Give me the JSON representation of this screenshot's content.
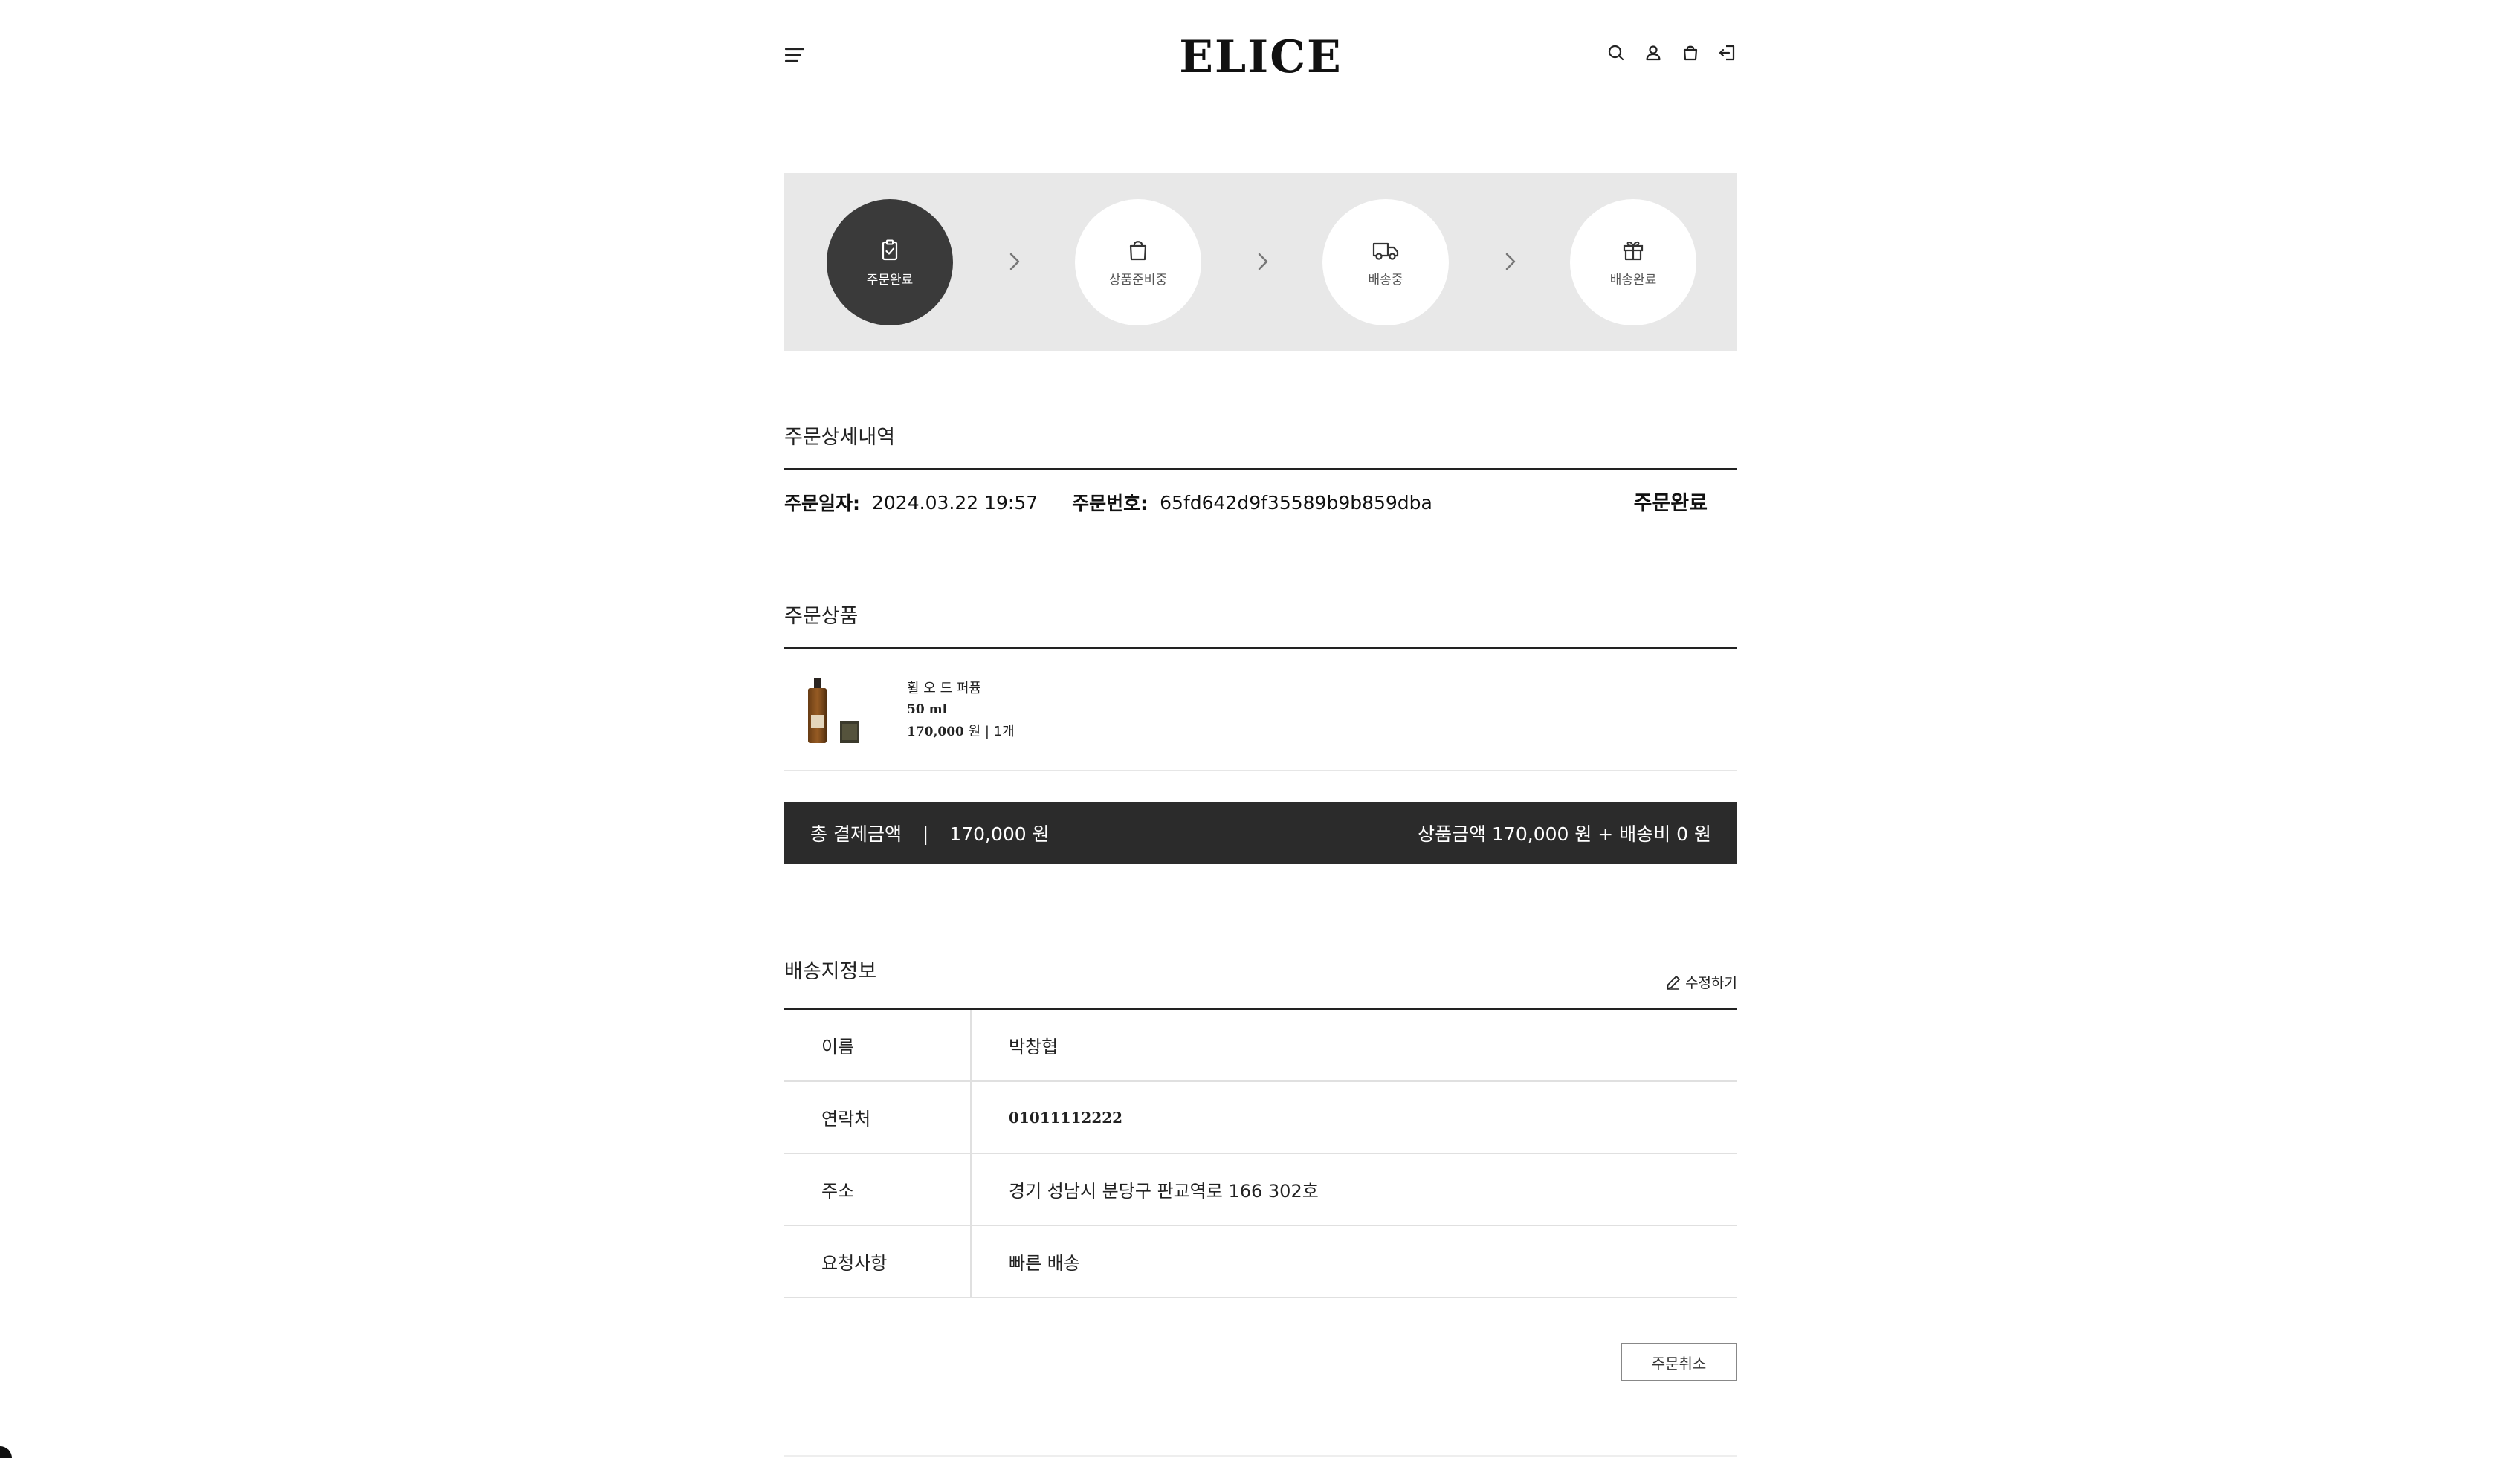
{
  "header": {
    "logo": "ELICE",
    "icons": [
      "menu-icon",
      "search-icon",
      "user-icon",
      "cart-icon",
      "logout-icon"
    ]
  },
  "progress": {
    "steps": [
      {
        "label": "주문완료",
        "icon": "clipboard-check-icon",
        "active": true
      },
      {
        "label": "상품준비중",
        "icon": "shopping-bag-icon",
        "active": false
      },
      {
        "label": "배송중",
        "icon": "truck-icon",
        "active": false
      },
      {
        "label": "배송완료",
        "icon": "gift-icon",
        "active": false
      }
    ]
  },
  "order_detail": {
    "title": "주문상세내역",
    "date_label": "주문일자:",
    "date_value": "2024.03.22 19:57",
    "number_label": "주문번호:",
    "number_value": "65fd642d9f35589b9b859dba",
    "status": "주문완료"
  },
  "order_items": {
    "title": "주문상품",
    "items": [
      {
        "name": "휠 오 드 퍼퓸",
        "volume": "50 ml",
        "price": "170,000",
        "price_unit": "원 | 1개"
      }
    ]
  },
  "total": {
    "label": "총 결제금액",
    "separator": "|",
    "amount": "170,000 원",
    "breakdown": "상품금액 170,000 원 + 배송비 0 원"
  },
  "shipping": {
    "title": "배송지정보",
    "edit_label": "수정하기",
    "rows": [
      {
        "label": "이름",
        "value": "박창협"
      },
      {
        "label": "연락처",
        "value": "01011112222"
      },
      {
        "label": "주소",
        "value": "경기 성남시 분당구 판교역로 166  302호"
      },
      {
        "label": "요청사항",
        "value": "빠른 배송"
      }
    ]
  },
  "cancel_label": "주문취소",
  "colors": {
    "dark": "#2b2b2b",
    "step_active": "#3a3a3a",
    "band": "#e8e8e8"
  }
}
